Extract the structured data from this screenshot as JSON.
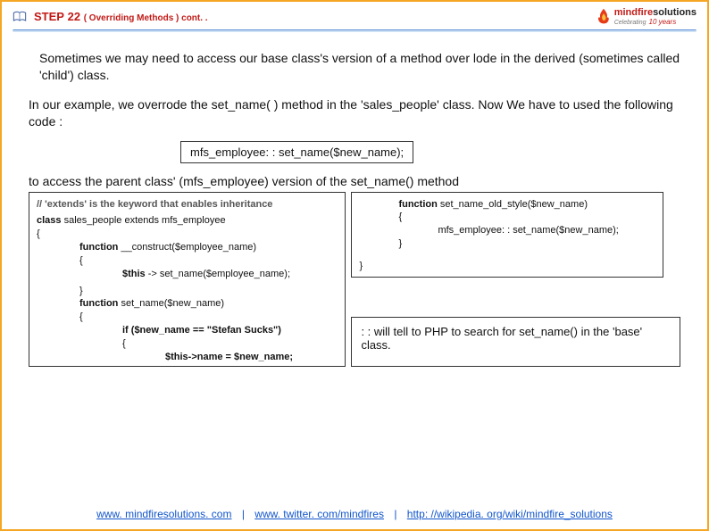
{
  "header": {
    "step_label": "STEP",
    "step_number": "22",
    "subtitle": "( Overriding  Methods  ) cont. ."
  },
  "logo": {
    "brand1": "mindfire",
    "brand2": "solutions",
    "tagline": "Celebrating",
    "years": "10 years"
  },
  "body": {
    "p1": "Sometimes we may need to access our base class's version of a method  over lode in the derived (sometimes called 'child') class.",
    "p2": "In our example, we overrode the set_name( ) method in the 'sales_people' class. Now We have to used the following code :",
    "code_inline": "mfs_employee: : set_name($new_name);",
    "p3": "to access the parent class' (mfs_employee) version of the set_name() method"
  },
  "code_left": {
    "l1": "// 'extends' is the keyword that enables inheritance",
    "l2": "class",
    "l2b": " sales_people extends mfs_employee",
    "l3": "{",
    "l4": "function",
    "l4b": " __construct($employee_name)",
    "l5": "{",
    "l6": "$this",
    "l6b": " ->  set_name($employee_name);",
    "l7": "}",
    "l8": "function",
    "l8b": " set_name($new_name)",
    "l9": "{",
    "l10": "if ($new_name == \"Stefan Sucks\")",
    "l11": "{",
    "l12": "$this->name = $new_name;",
    "l13": "}",
    "l14": "}"
  },
  "code_right": {
    "r1": "function",
    "r1b": " set_name_old_style($new_name)",
    "r2": "{",
    "r3": "mfs_employee: : set_name($new_name);",
    "r4": "}",
    "r5": "}"
  },
  "note": ": : will tell to PHP  to search for set_name() in the 'base' class.",
  "footer": {
    "link1": "www. mindfiresolutions. com",
    "link2": "www. twitter. com/mindfires",
    "link3": "http: //wikipedia. org/wiki/mindfire_solutions",
    "sep": "|"
  }
}
